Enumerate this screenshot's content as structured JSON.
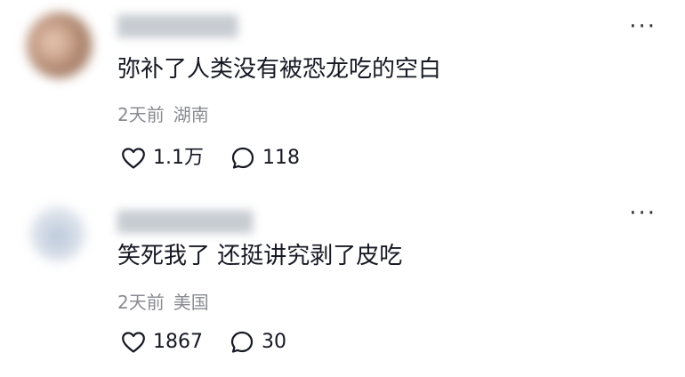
{
  "comments": [
    {
      "username": "",
      "text": "弥补了人类没有被恐龙吃的空白",
      "time": "2天前",
      "location": "湖南",
      "likes": "1.1万",
      "replies": "118",
      "more_icon": "ellipsis-icon",
      "like_icon": "heart-icon",
      "reply_icon": "comment-bubble-icon"
    },
    {
      "username": "",
      "text": "笑死我了 还挺讲究剥了皮吃",
      "time": "2天前",
      "location": "美国",
      "likes": "1867",
      "replies": "30",
      "more_icon": "ellipsis-icon",
      "like_icon": "heart-icon",
      "reply_icon": "comment-bubble-icon"
    }
  ],
  "colors": {
    "text": "#161823",
    "meta": "#8a8b91",
    "background": "#ffffff"
  }
}
